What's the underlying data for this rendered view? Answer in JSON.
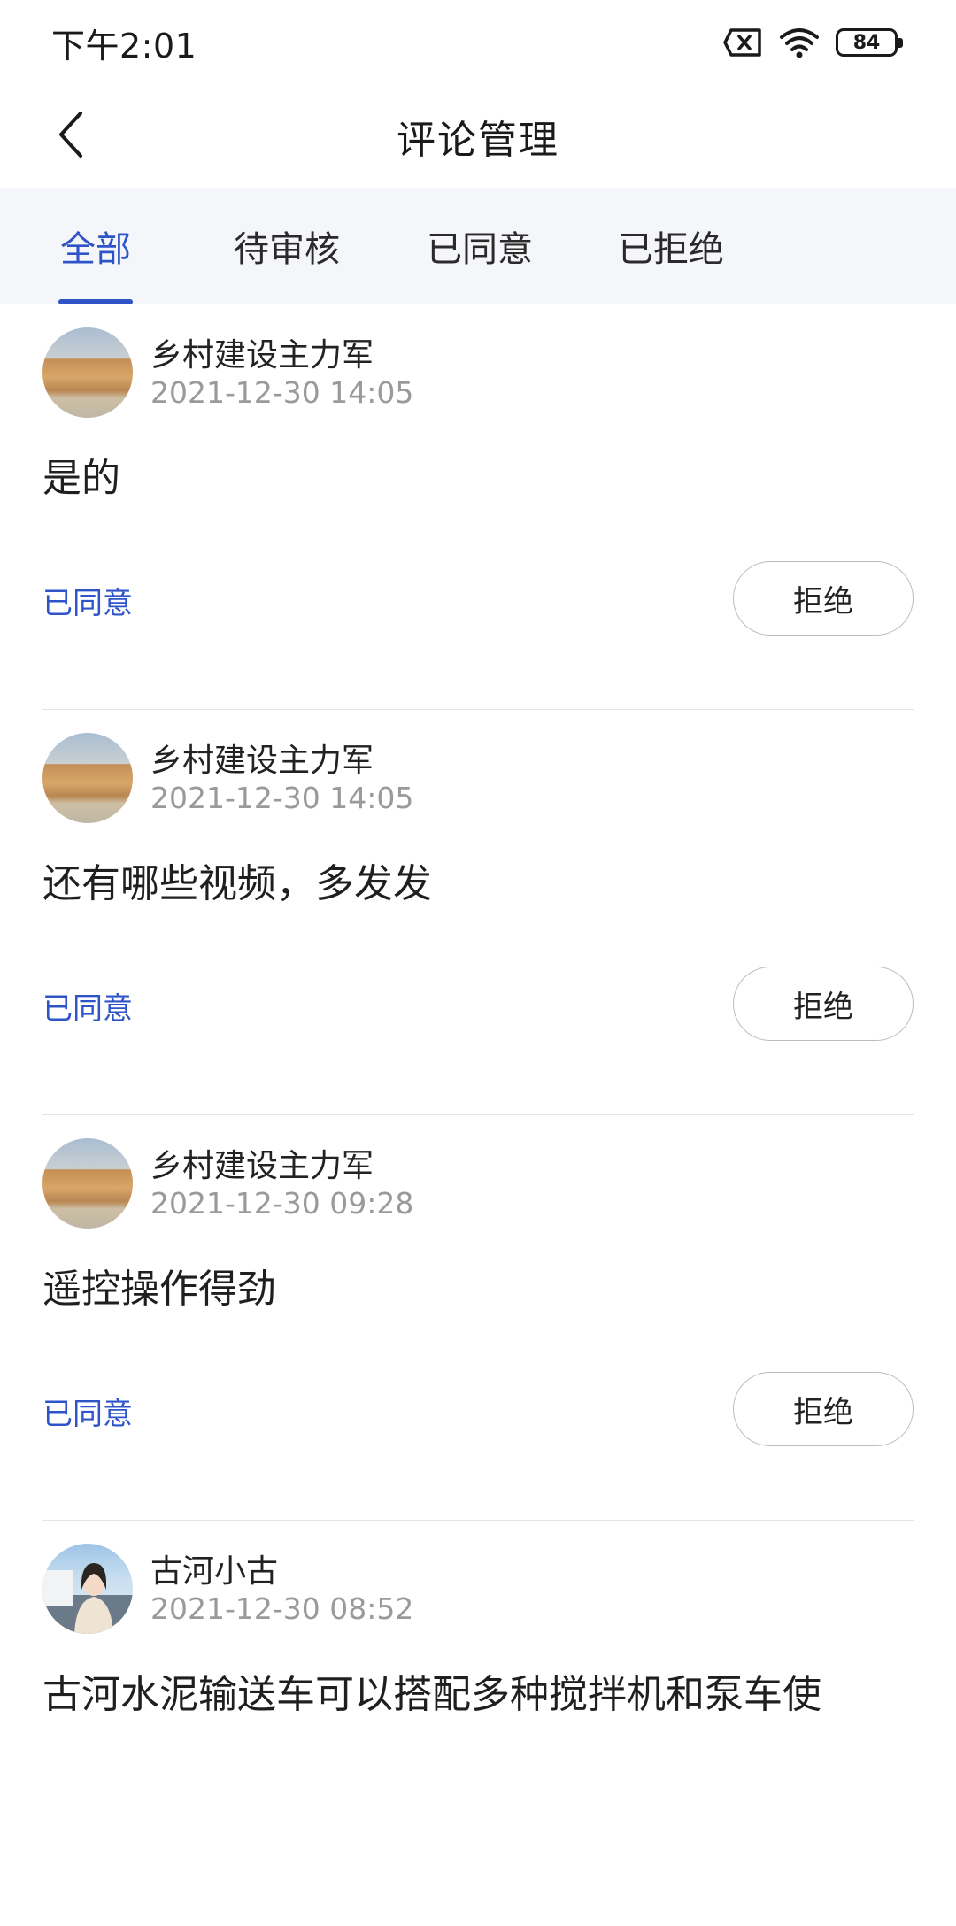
{
  "status_bar": {
    "time": "下午2:01",
    "battery": "84",
    "icons": [
      "sim-x-icon",
      "wifi-icon",
      "battery-icon"
    ]
  },
  "header": {
    "title": "评论管理",
    "back_icon": "chevron-left-icon"
  },
  "tabs": [
    {
      "label": "全部",
      "active": true
    },
    {
      "label": "待审核",
      "active": false
    },
    {
      "label": "已同意",
      "active": false
    },
    {
      "label": "已拒绝",
      "active": false
    }
  ],
  "accent_color": "#2f54c8",
  "comments": [
    {
      "author": "乡村建设主力军",
      "time": "2021-12-30 14:05",
      "content": "是的",
      "status": "已同意",
      "action": "拒绝",
      "avatar": "landscape-avatar"
    },
    {
      "author": "乡村建设主力军",
      "time": "2021-12-30 14:05",
      "content": "还有哪些视频，多发发",
      "status": "已同意",
      "action": "拒绝",
      "avatar": "landscape-avatar"
    },
    {
      "author": "乡村建设主力军",
      "time": "2021-12-30 09:28",
      "content": "遥控操作得劲",
      "status": "已同意",
      "action": "拒绝",
      "avatar": "landscape-avatar"
    },
    {
      "author": "古河小古",
      "time": "2021-12-30 08:52",
      "content": "古河水泥输送车可以搭配多种搅拌机和泵车使",
      "status": "",
      "action": "",
      "avatar": "person-avatar"
    }
  ]
}
